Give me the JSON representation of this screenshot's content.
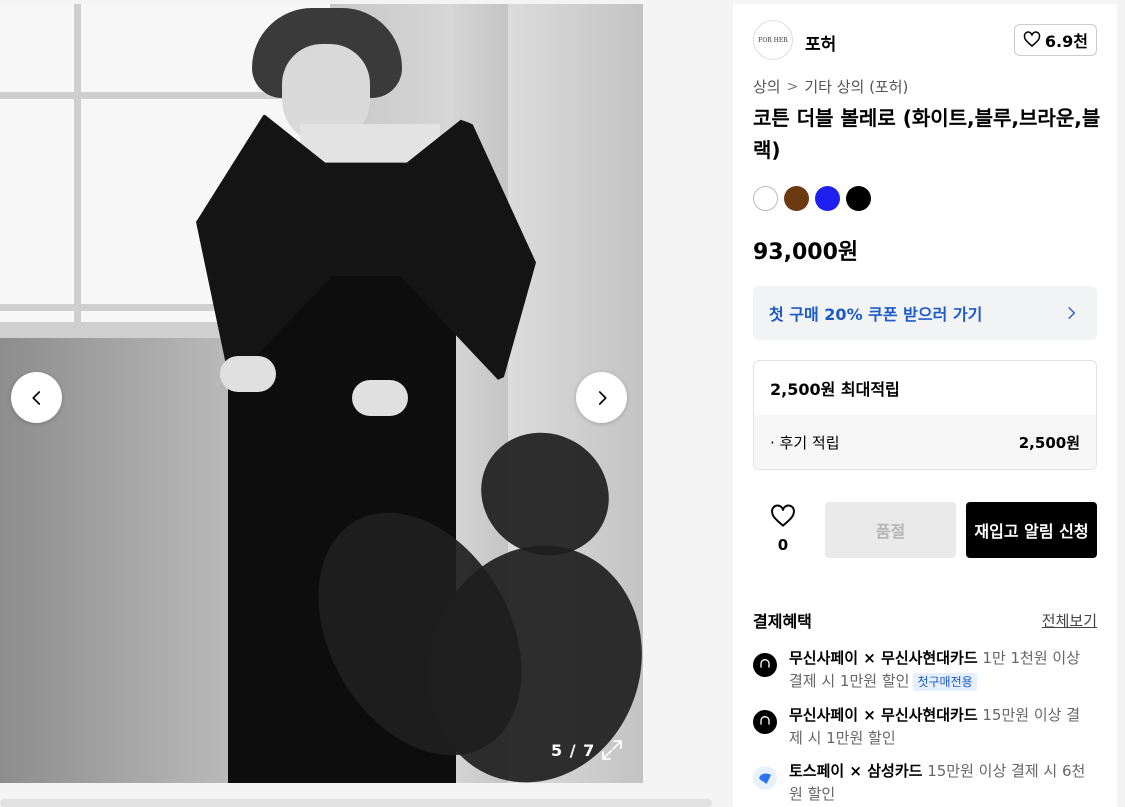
{
  "gallery": {
    "counter": "5 / 7",
    "prev_label": "이전 이미지",
    "next_label": "다음 이미지"
  },
  "brand": {
    "logo_text": "FOR HER",
    "name": "포허",
    "like_count": "6.9천"
  },
  "breadcrumb": {
    "category": "상의",
    "separator": ">",
    "subcategory": "기타 상의 (포허)"
  },
  "product": {
    "title": "코튼 더블 볼레로 (화이트,블루,브라운,블랙)",
    "swatches": [
      {
        "name": "white",
        "color": "#ffffff"
      },
      {
        "name": "brown",
        "color": "#6b3a10"
      },
      {
        "name": "blue",
        "color": "#1f1ff0"
      },
      {
        "name": "black",
        "color": "#000000"
      }
    ],
    "price": "93,000원"
  },
  "coupon": {
    "label": "첫 구매 20% 쿠폰 받으러 가기"
  },
  "points": {
    "max": "2,500원 최대적립",
    "review_label": "· 후기 적립",
    "review_amount": "2,500원"
  },
  "actions": {
    "wish_count": "0",
    "soldout_label": "품절",
    "restock_label": "재입고 알림 신청"
  },
  "benefits": {
    "heading": "결제혜택",
    "view_all": "전체보기",
    "items": [
      {
        "brand": "무신사페이 × 무신사현대카드",
        "desc": " 1만 1천원 이상 결제 시 1만원 할인",
        "tag": "첫구매전용",
        "icon": "musinsa-card-icon"
      },
      {
        "brand": "무신사페이 × 무신사현대카드",
        "desc": " 15만원 이상 결제 시 1만원 할인",
        "tag": "",
        "icon": "musinsa-card-icon"
      },
      {
        "brand": "토스페이 × 삼성카드",
        "desc": " 15만원 이상 결제 시 6천원 할인",
        "tag": "",
        "icon": "toss-icon"
      }
    ]
  },
  "colors": {
    "accent_blue": "#1c5ac8",
    "primary_button": "#000000",
    "disabled_button": "#eaeaea"
  }
}
